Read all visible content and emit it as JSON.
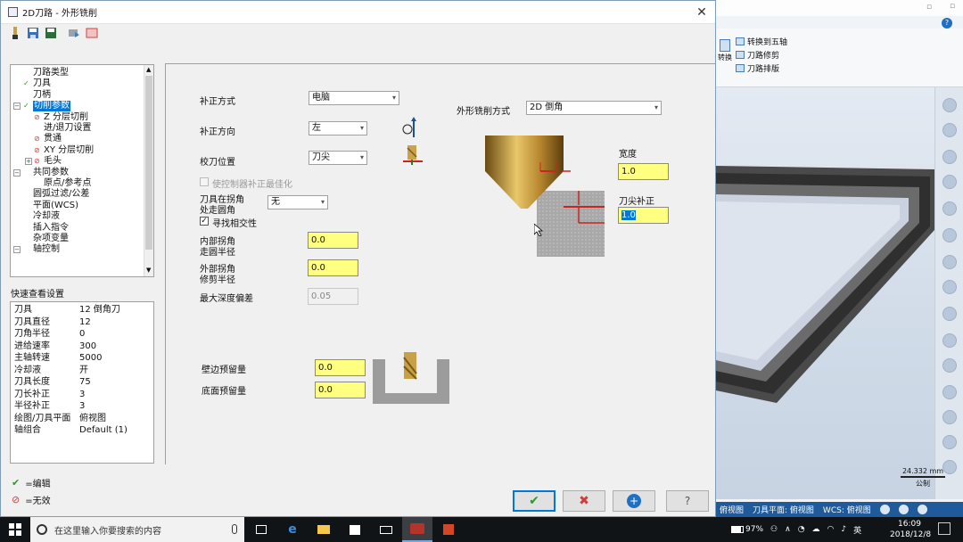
{
  "dialog": {
    "title": "2D刀路 - 外形铣削",
    "close_glyph": "✕"
  },
  "tree": {
    "items": [
      {
        "label": "刀路类型",
        "mark": ""
      },
      {
        "label": "刀具",
        "mark": "ok"
      },
      {
        "label": "刀柄",
        "mark": ""
      },
      {
        "label": "切削参数",
        "mark": "ok",
        "selected": true
      },
      {
        "label": "Z 分层切削",
        "mark": "bad"
      },
      {
        "label": "进/退刀设置",
        "mark": ""
      },
      {
        "label": "贯通",
        "mark": "bad"
      },
      {
        "label": "XY 分层切削",
        "mark": "bad"
      },
      {
        "label": "毛头",
        "mark": "bad"
      },
      {
        "label": "共同参数",
        "mark": ""
      },
      {
        "label": "原点/参考点",
        "mark": ""
      },
      {
        "label": "圆弧过滤/公差",
        "mark": ""
      },
      {
        "label": "平面(WCS)",
        "mark": ""
      },
      {
        "label": "冷却液",
        "mark": ""
      },
      {
        "label": "插入指令",
        "mark": ""
      },
      {
        "label": "杂项变量",
        "mark": ""
      },
      {
        "label": "轴控制",
        "mark": ""
      }
    ]
  },
  "quick": {
    "title": "快速查看设置",
    "rows": [
      {
        "key": "刀具",
        "value": "12 倒角刀"
      },
      {
        "key": "刀具直径",
        "value": "12"
      },
      {
        "key": "刀角半径",
        "value": "0"
      },
      {
        "key": "进给速率",
        "value": "300"
      },
      {
        "key": "主轴转速",
        "value": "5000"
      },
      {
        "key": "冷却液",
        "value": "开"
      },
      {
        "key": "刀具长度",
        "value": "75"
      },
      {
        "key": "刀长补正",
        "value": "3"
      },
      {
        "key": "半径补正",
        "value": "3"
      },
      {
        "key": "绘图/刀具平面",
        "value": "俯视图"
      },
      {
        "key": "轴组合",
        "value": "Default (1)"
      }
    ]
  },
  "legend": {
    "edit": "=编辑",
    "invalid": "=无效"
  },
  "params": {
    "comp_type_label": "补正方式",
    "comp_type_value": "电脑",
    "comp_dir_label": "补正方向",
    "comp_dir_value": "左",
    "tip_comp_label": "校刀位置",
    "tip_comp_value": "刀尖",
    "optimize_label": "使控制器补正最佳化",
    "corner_label_1": "刀具在拐角",
    "corner_label_2": "处走圆角",
    "corner_value": "无",
    "infinite_label": "寻找相交性",
    "inner_label_1": "内部拐角",
    "inner_label_2": "走圆半径",
    "inner_value": "0.0",
    "outer_label_1": "外部拐角",
    "outer_label_2": "修剪半径",
    "outer_value": "0.0",
    "max_depth_label": "最大深度偏差",
    "max_depth_value": "0.05",
    "wall_stock_label": "壁边预留量",
    "wall_stock_value": "0.0",
    "floor_stock_label": "底面预留量",
    "floor_stock_value": "0.0",
    "contour_type_label": "外形铣削方式",
    "contour_type_value": "2D 倒角",
    "width_label": "宽度",
    "width_value": "1.0",
    "tip_offset_label": "刀尖补正",
    "tip_offset_value": "1.0"
  },
  "background": {
    "ribbon_items": [
      "转换到五轴",
      "刀路修剪",
      "刀路排版"
    ],
    "ribbon_partial": "转换",
    "status_items": [
      "俯视图",
      "刀具平面: 俯视图",
      "WCS: 俯视图"
    ],
    "scale_value": "24.332 mm",
    "scale_unit": "公制"
  },
  "taskbar": {
    "search_placeholder": "在这里输入你要搜索的内容",
    "battery": "97%",
    "ime": "英",
    "time": "16:09",
    "date": "2018/12/8"
  }
}
